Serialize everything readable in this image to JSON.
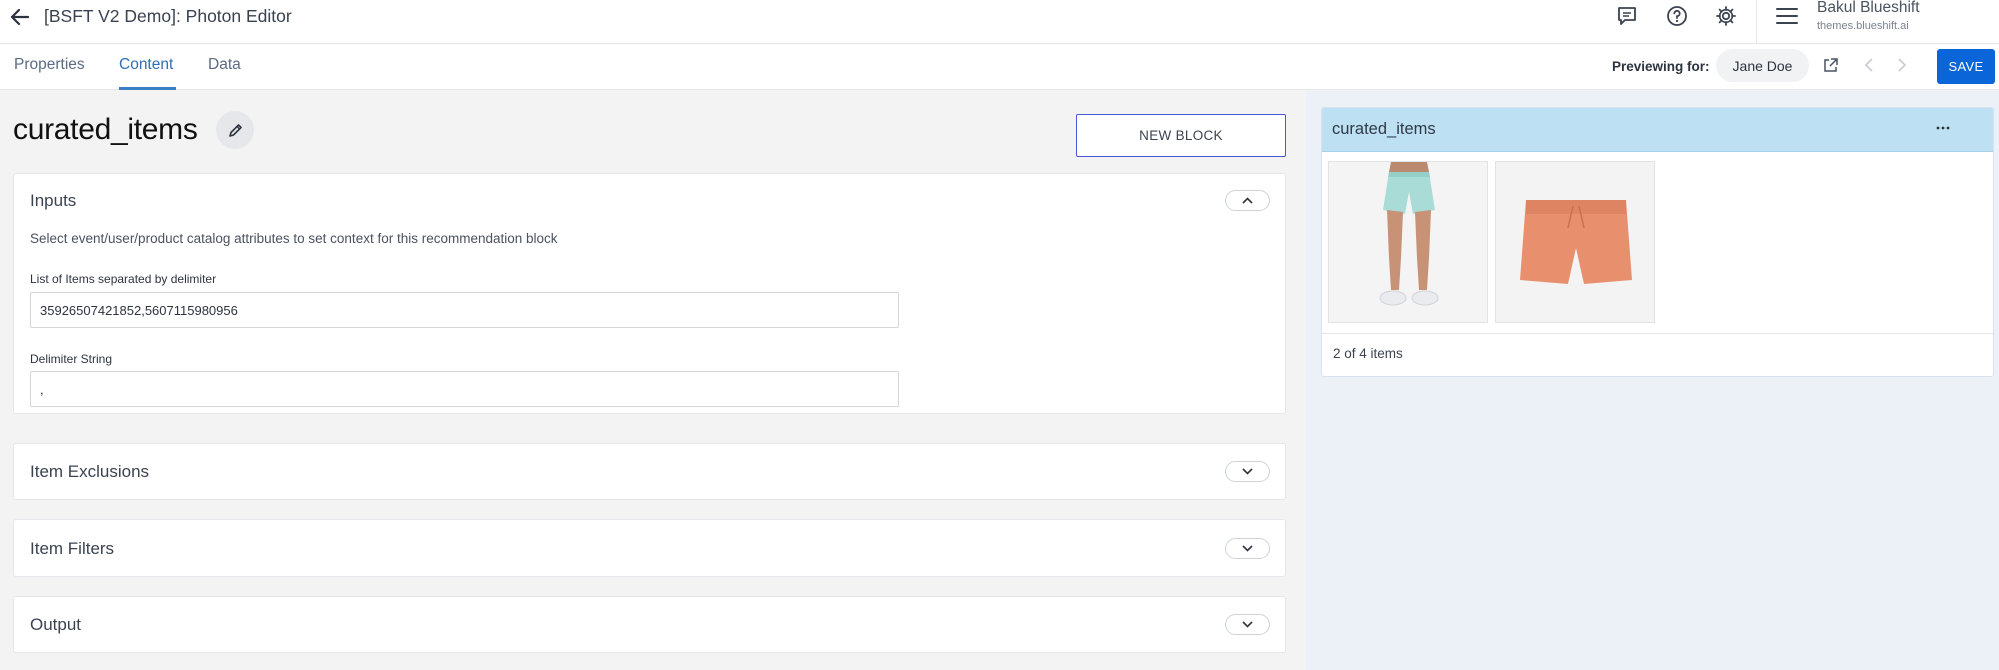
{
  "header": {
    "title": "[BSFT V2 Demo]: Photon Editor",
    "user_name": "Bakul Blueshift",
    "user_sub": "themes.blueshift.ai",
    "icons": [
      "back-arrow-icon",
      "comment-icon",
      "help-icon",
      "gear-icon",
      "menu-icon"
    ]
  },
  "tabs": [
    {
      "label": "Properties",
      "active": false
    },
    {
      "label": "Content",
      "active": true
    },
    {
      "label": "Data",
      "active": false
    }
  ],
  "preview": {
    "label": "Previewing for:",
    "user": "Jane Doe",
    "save_label": "SAVE"
  },
  "editor": {
    "block_title": "curated_items",
    "new_block_label": "NEW BLOCK",
    "inputs": {
      "title": "Inputs",
      "expanded": true,
      "description": "Select event/user/product catalog attributes to set context for this recommendation block",
      "list_label": "List of Items separated by delimiter",
      "list_value": "35926507421852,5607115980956",
      "delimiter_label": "Delimiter String",
      "delimiter_value": ","
    },
    "sections": [
      {
        "title": "Item Exclusions",
        "expanded": false
      },
      {
        "title": "Item Filters",
        "expanded": false
      },
      {
        "title": "Output",
        "expanded": false
      }
    ]
  },
  "preview_panel": {
    "title": "curated_items",
    "more_icon": "more-horizontal-icon",
    "products": [
      {
        "description": "light mint running shorts on model"
      },
      {
        "description": "orange shorts flat lay"
      }
    ],
    "count_text": "2 of 4 items"
  },
  "colors": {
    "accent": "#0a66d8",
    "tab_active": "#2f6fb6",
    "preview_header": "#bde0f3",
    "new_block_border": "#4a56d6"
  }
}
